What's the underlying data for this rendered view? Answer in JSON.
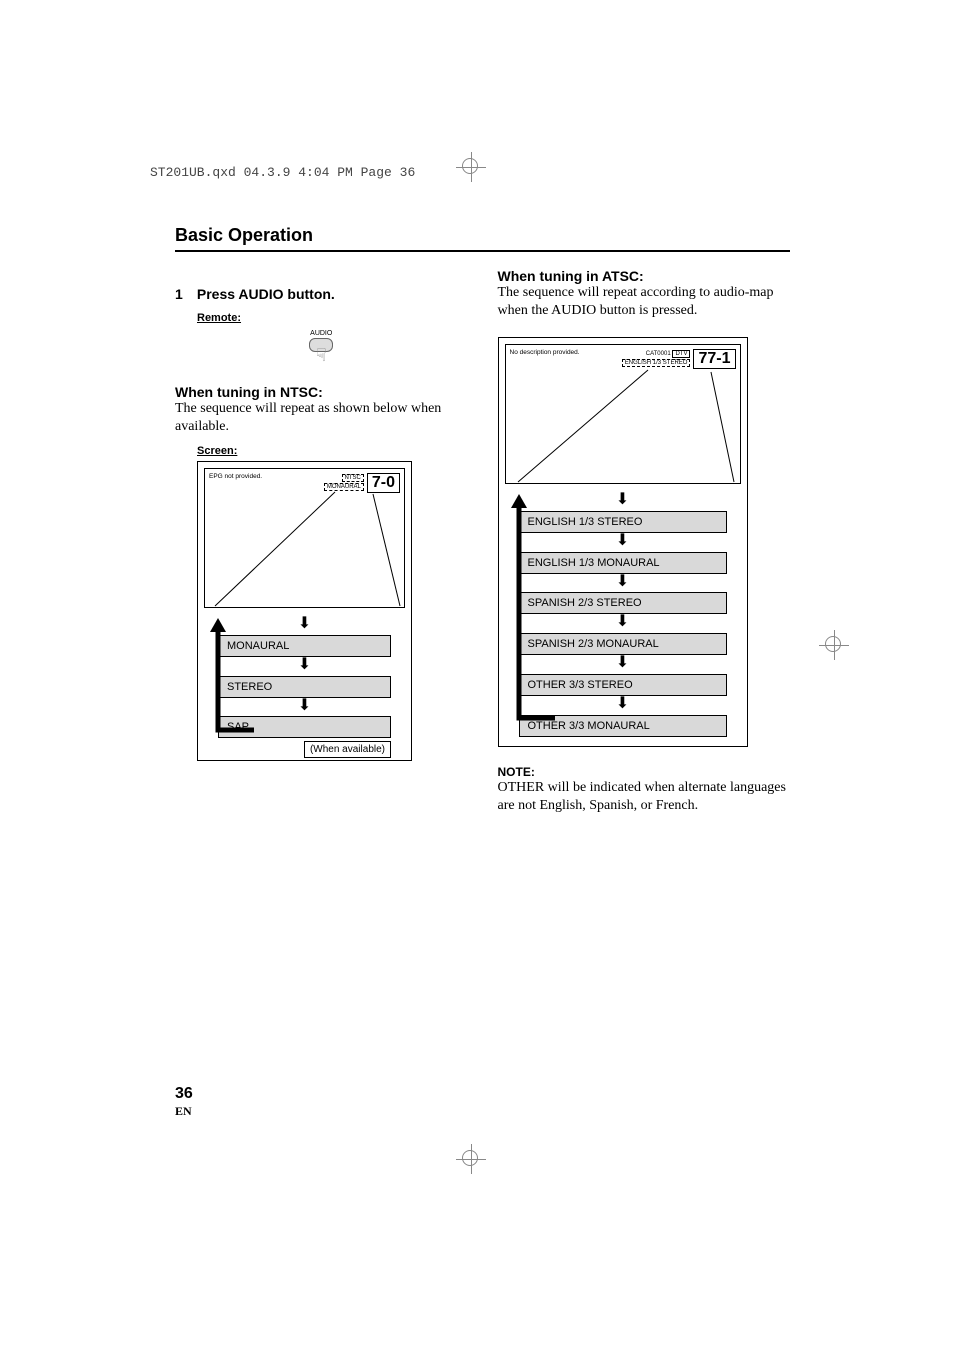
{
  "header_line": "ST201UB.qxd  04.3.9  4:04 PM  Page 36",
  "section_title": "Basic Operation",
  "left": {
    "step_number": "1",
    "step_text": "Press AUDIO button.",
    "remote_label": "Remote:",
    "remote_button": "AUDIO",
    "ntsc_heading": "When tuning in NTSC:",
    "ntsc_text": "The sequence will repeat as shown below when available.",
    "screen_label": "Screen:",
    "osd_left": "EPG not provided.",
    "osd_tag1": "NTSC",
    "osd_tag2": "MONAURAL",
    "channel": "7-0",
    "flow": [
      "MONAURAL",
      "STEREO",
      "SAP"
    ],
    "when_available": "(When available)"
  },
  "right": {
    "atsc_heading": "When tuning in ATSC:",
    "atsc_text": "The sequence will repeat according to audio-map when the AUDIO button is pressed.",
    "osd_left": "No description provided.",
    "osd_tag1": "CAT0001",
    "osd_tag2": "DTV",
    "osd_tag3": "ENGLISH 1/3 STEREO",
    "channel": "77-1",
    "flow": [
      "ENGLISH 1/3 STEREO",
      "ENGLISH 1/3 MONAURAL",
      "SPANISH 2/3 STEREO",
      "SPANISH 2/3 MONAURAL",
      "OTHER 3/3 STEREO",
      "OTHER 3/3 MONAURAL"
    ],
    "note_label": "NOTE:",
    "note_text": "OTHER will be indicated when alternate languages are not English, Spanish, or  French."
  },
  "page_number": "36",
  "page_lang": "EN"
}
